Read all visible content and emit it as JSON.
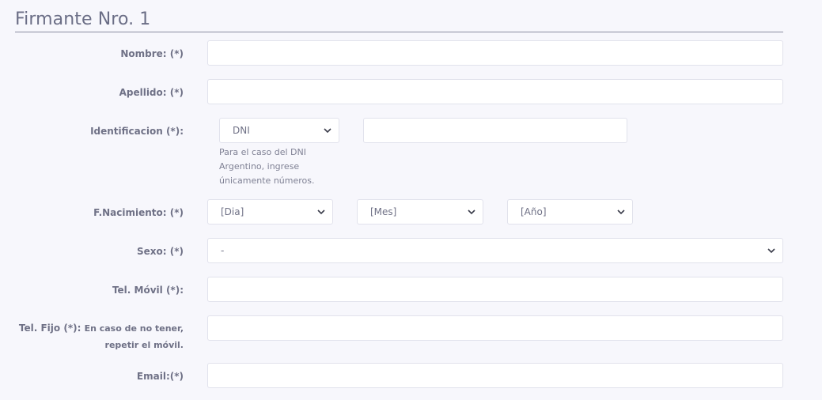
{
  "section": {
    "title": "Firmante Nro. 1"
  },
  "form": {
    "nombre_label": "Nombre: (*)",
    "apellido_label": "Apellido: (*)",
    "identificacion_label": "Identificacion (*):",
    "id_type_selected": "DNI",
    "id_hint": "Para el caso del DNI Argentino, ingrese únicamente números.",
    "nacimiento_label": "F.Nacimiento: (*)",
    "dia_selected": "[Dia]",
    "mes_selected": "[Mes]",
    "anio_selected": "[Año]",
    "sexo_label": "Sexo: (*)",
    "sexo_selected": "-",
    "movil_label": "Tel. Móvil (*):",
    "fijo_label_main": "Tel. Fijo (*):",
    "fijo_label_sub_a": "En caso de no tener,",
    "fijo_label_sub_b": "repetir el móvil.",
    "email_label": "Email:(*)"
  },
  "icons": {
    "chevron": "chevron-down-icon"
  }
}
